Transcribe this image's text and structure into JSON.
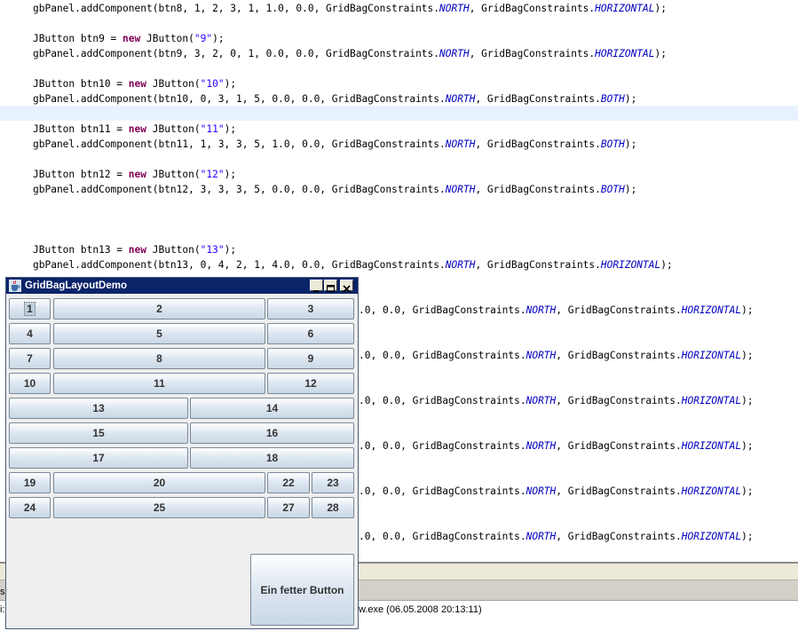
{
  "editor": {
    "lines": [
      {
        "segs": [
          {
            "t": "gbPanel.addComponent(btn8, 1, 2, 3, 1, 1.0, 0.0, GridBagConstraints."
          },
          {
            "t": "NORTH",
            "c": "cst"
          },
          {
            "t": ", GridBagConstraints."
          },
          {
            "t": "HORIZONTAL",
            "c": "cst"
          },
          {
            "t": ");"
          }
        ]
      },
      {
        "segs": [
          {
            "t": "JButton btn9 = "
          },
          {
            "t": "new",
            "c": "kw"
          },
          {
            "t": " JButton("
          },
          {
            "t": "\"9\"",
            "c": "str"
          },
          {
            "t": ");"
          }
        ]
      },
      {
        "segs": [
          {
            "t": "gbPanel.addComponent(btn9, 3, 2, 0, 1, 0.0, 0.0, GridBagConstraints."
          },
          {
            "t": "NORTH",
            "c": "cst"
          },
          {
            "t": ", GridBagConstraints."
          },
          {
            "t": "HORIZONTAL",
            "c": "cst"
          },
          {
            "t": ");"
          }
        ]
      },
      {
        "segs": [
          {
            "t": "JButton btn10 = "
          },
          {
            "t": "new",
            "c": "kw"
          },
          {
            "t": " JButton("
          },
          {
            "t": "\"10\"",
            "c": "str"
          },
          {
            "t": ");"
          }
        ]
      },
      {
        "segs": [
          {
            "t": "gbPanel.addComponent(btn10, 0, 3, 1, 5, 0.0, 0.0, GridBagConstraints."
          },
          {
            "t": "NORTH",
            "c": "cst"
          },
          {
            "t": ", GridBagConstraints."
          },
          {
            "t": "BOTH",
            "c": "cst"
          },
          {
            "t": ");"
          }
        ]
      },
      {
        "segs": [
          {
            "t": "JButton btn11 = "
          },
          {
            "t": "new",
            "c": "kw"
          },
          {
            "t": " JButton("
          },
          {
            "t": "\"11\"",
            "c": "str"
          },
          {
            "t": ");"
          }
        ]
      },
      {
        "segs": [
          {
            "t": "gbPanel.addComponent(btn11, 1, 3, 3, 5, 1.0, 0.0, GridBagConstraints."
          },
          {
            "t": "NORTH",
            "c": "cst"
          },
          {
            "t": ", GridBagConstraints."
          },
          {
            "t": "BOTH",
            "c": "cst"
          },
          {
            "t": ");"
          }
        ]
      },
      {
        "segs": [
          {
            "t": "JButton btn12 = "
          },
          {
            "t": "new",
            "c": "kw"
          },
          {
            "t": " JButton("
          },
          {
            "t": "\"12\"",
            "c": "str"
          },
          {
            "t": ");"
          }
        ]
      },
      {
        "segs": [
          {
            "t": "gbPanel.addComponent(btn12, 3, 3, 3, 5, 0.0, 0.0, GridBagConstraints."
          },
          {
            "t": "NORTH",
            "c": "cst"
          },
          {
            "t": ", GridBagConstraints."
          },
          {
            "t": "BOTH",
            "c": "cst"
          },
          {
            "t": ");"
          }
        ]
      },
      {
        "segs": [
          {
            "t": "JButton btn13 = "
          },
          {
            "t": "new",
            "c": "kw"
          },
          {
            "t": " JButton("
          },
          {
            "t": "\"13\"",
            "c": "str"
          },
          {
            "t": ");"
          }
        ]
      },
      {
        "segs": [
          {
            "t": "gbPanel.addComponent(btn13, 0, 4, 2, 1, 4.0, 0.0, GridBagConstraints."
          },
          {
            "t": "NORTH",
            "c": "cst"
          },
          {
            "t": ", GridBagConstraints."
          },
          {
            "t": "HORIZONTAL",
            "c": "cst"
          },
          {
            "t": ");"
          }
        ]
      },
      {
        "segs": [
          {
            "t": ".0, 0.0, GridBagConstraints."
          },
          {
            "t": "NORTH",
            "c": "cst"
          },
          {
            "t": ", GridBagConstraints."
          },
          {
            "t": "HORIZONTAL",
            "c": "cst"
          },
          {
            "t": ");"
          }
        ]
      },
      {
        "segs": [
          {
            "t": ".0, 0.0, GridBagConstraints."
          },
          {
            "t": "NORTH",
            "c": "cst"
          },
          {
            "t": ", GridBagConstraints."
          },
          {
            "t": "HORIZONTAL",
            "c": "cst"
          },
          {
            "t": ");"
          }
        ]
      },
      {
        "segs": [
          {
            "t": ".0, 0.0, GridBagConstraints."
          },
          {
            "t": "NORTH",
            "c": "cst"
          },
          {
            "t": ", GridBagConstraints."
          },
          {
            "t": "HORIZONTAL",
            "c": "cst"
          },
          {
            "t": ");"
          }
        ]
      },
      {
        "segs": [
          {
            "t": ".0, 0.0, GridBagConstraints."
          },
          {
            "t": "NORTH",
            "c": "cst"
          },
          {
            "t": ", GridBagConstraints."
          },
          {
            "t": "HORIZONTAL",
            "c": "cst"
          },
          {
            "t": ");"
          }
        ]
      },
      {
        "segs": [
          {
            "t": ".0, 0.0, GridBagConstraints."
          },
          {
            "t": "NORTH",
            "c": "cst"
          },
          {
            "t": ", GridBagConstraints."
          },
          {
            "t": "HORIZONTAL",
            "c": "cst"
          },
          {
            "t": ");"
          }
        ]
      },
      {
        "segs": [
          {
            "t": ".0, 0.0, GridBagConstraints."
          },
          {
            "t": "NORTH",
            "c": "cst"
          },
          {
            "t": ", GridBagConstraints."
          },
          {
            "t": "HORIZONTAL",
            "c": "cst"
          },
          {
            "t": ");"
          }
        ]
      }
    ]
  },
  "console": {
    "title": "w.exe (06.05.2008 20:13:11)",
    "left_stub_1": "s",
    "left_stub_2": "i:"
  },
  "window": {
    "title": "GridBagLayoutDemo",
    "buttons": [
      "1",
      "2",
      "3",
      "4",
      "5",
      "6",
      "7",
      "8",
      "9",
      "10",
      "11",
      "12",
      "13",
      "14",
      "15",
      "16",
      "17",
      "18",
      "19",
      "20",
      "22",
      "23",
      "24",
      "25",
      "27",
      "28"
    ],
    "fat_button": "Ein fetter Button"
  },
  "colors": {
    "keyword": "#7f0055",
    "string": "#2a00ff",
    "constant": "#0000c0",
    "titlebar": "#0a246a",
    "current_line": "#e8f2fe"
  }
}
